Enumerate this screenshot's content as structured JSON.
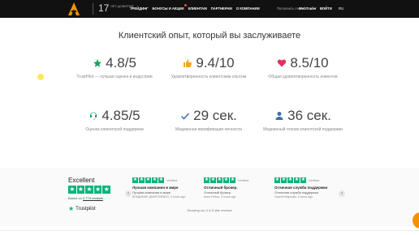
{
  "header": {
    "years_number": "17",
    "years_text": "лет доверия",
    "nav": [
      "ТРЕЙДИНГ",
      "БОНУСЫ И АКЦИИ",
      "КЛИЕНТАМ",
      "ПАРТНЕРАМ",
      "О КОМПАНИИ"
    ],
    "topup": "Пополнить счет",
    "webtrader": "WebTrader",
    "login": "ВОЙТИ",
    "lang": "RU"
  },
  "section_title": "Клиентский опыт, который вы заслуживаете",
  "stats": [
    {
      "value": "4.8/5",
      "desc": "TrustPilot — лучшая оценка в индустрии",
      "icon": "star-icon",
      "color": "#1aa260"
    },
    {
      "value": "9.4/10",
      "desc": "Удовлетворенность клиентским опытом",
      "icon": "thumbs-up-icon",
      "color": "#f5a623"
    },
    {
      "value": "8.5/10",
      "desc": "Общая удовлетворенность клиентов",
      "icon": "heart-icon",
      "color": "#e0325a"
    },
    {
      "value": "4.85/5",
      "desc": "Оценка клиентской поддержки",
      "icon": "headset-icon",
      "color": "#1aa260"
    },
    {
      "value": "29 сек.",
      "desc": "Медианная верификация личности",
      "icon": "check-icon",
      "color": "#3a6fb0"
    },
    {
      "value": "36 сек.",
      "desc": "Медианный отклик клиентской поддержки",
      "icon": "user-icon",
      "color": "#3a6fb0"
    }
  ],
  "trustpilot": {
    "rating_word": "Excellent",
    "based_prefix": "Based on",
    "based_count": "2,774 reviews",
    "logo_text": "Trustpilot",
    "showing": "Showing our 4 & 5 star reviews",
    "reviews": [
      {
        "title": "Лучшая компания в мире",
        "text": "Лучшая компания в мире",
        "author": "ВЛАДИМИР ДМИТРИЕВИЧ, 3 hours ago"
      },
      {
        "title": "Отличный брокер.",
        "text": "Отличный брокер.",
        "author": "Anna Pelton, 3 hours ago"
      },
      {
        "title": "Отличная служба поддержки",
        "text": "Отличная служба поддержки",
        "author": "Сергей Маркова, 4 hours ago"
      }
    ],
    "verified_label": "Verified",
    "star_color": "#00b67a"
  }
}
